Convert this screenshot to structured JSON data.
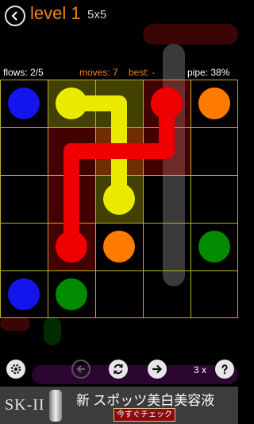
{
  "header": {
    "level_label": "level 1",
    "size_label": "5x5"
  },
  "stats": {
    "flows": "flows: 2/5",
    "moves": "moves: 7",
    "best": "best: -",
    "pipe": "pipe: 38%"
  },
  "colors": {
    "blue": "#1414ee",
    "yellow": "#eaea00",
    "red": "#ee0000",
    "orange": "#ff7b00",
    "green": "#008b00",
    "grid_line": "#c3a92f",
    "accent": "#f0831a"
  },
  "board": {
    "rows": 5,
    "cols": 5,
    "endpoints": [
      {
        "color": "blue",
        "row": 0,
        "col": 0
      },
      {
        "color": "blue",
        "row": 4,
        "col": 0
      },
      {
        "color": "yellow",
        "row": 0,
        "col": 1
      },
      {
        "color": "yellow",
        "row": 2,
        "col": 2
      },
      {
        "color": "red",
        "row": 0,
        "col": 3
      },
      {
        "color": "red",
        "row": 3,
        "col": 1
      },
      {
        "color": "orange",
        "row": 0,
        "col": 4
      },
      {
        "color": "orange",
        "row": 3,
        "col": 2
      },
      {
        "color": "green",
        "row": 3,
        "col": 4
      },
      {
        "color": "green",
        "row": 4,
        "col": 1
      }
    ],
    "paths": [
      {
        "color": "yellow",
        "cells": [
          [
            0,
            1
          ],
          [
            0,
            2
          ],
          [
            1,
            2
          ],
          [
            2,
            2
          ]
        ]
      },
      {
        "color": "red",
        "cells": [
          [
            0,
            3
          ],
          [
            1,
            3
          ],
          [
            1,
            2
          ],
          [
            1,
            1
          ],
          [
            2,
            1
          ],
          [
            3,
            1
          ]
        ]
      }
    ]
  },
  "controls": {
    "hints_label": "3 x",
    "settings_icon": "gear-icon",
    "prev_icon": "arrow-left-icon",
    "restart_icon": "restart-icon",
    "next_icon": "arrow-right-icon",
    "hint_icon": "question-icon"
  },
  "ad": {
    "brand": "SK-II",
    "headline": "新 スポッツ美白美容液",
    "cta": "今すぐチェック"
  }
}
